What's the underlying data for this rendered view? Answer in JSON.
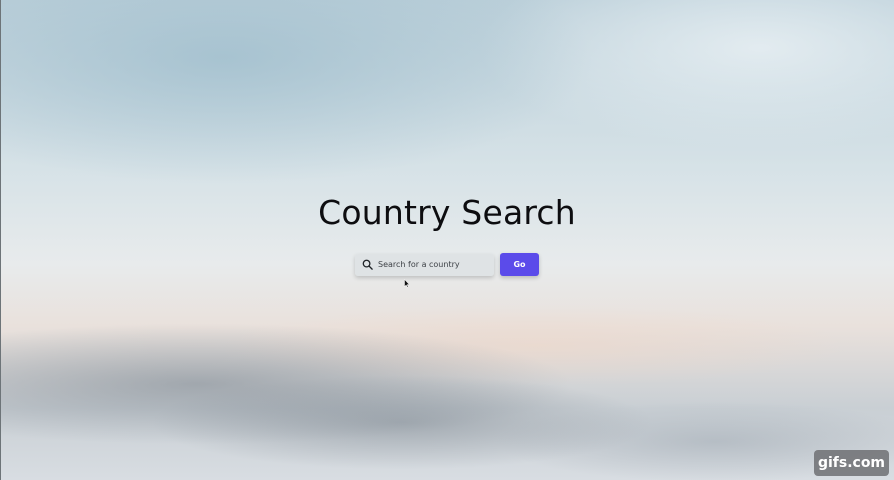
{
  "hero": {
    "title": "Country Search"
  },
  "search": {
    "placeholder": "Search for a country",
    "value": "",
    "button_label": "Go",
    "icon": "search-icon"
  },
  "colors": {
    "accent": "#5b4bea",
    "title": "#0d0d10"
  },
  "watermark": {
    "text": "gifs.com"
  }
}
